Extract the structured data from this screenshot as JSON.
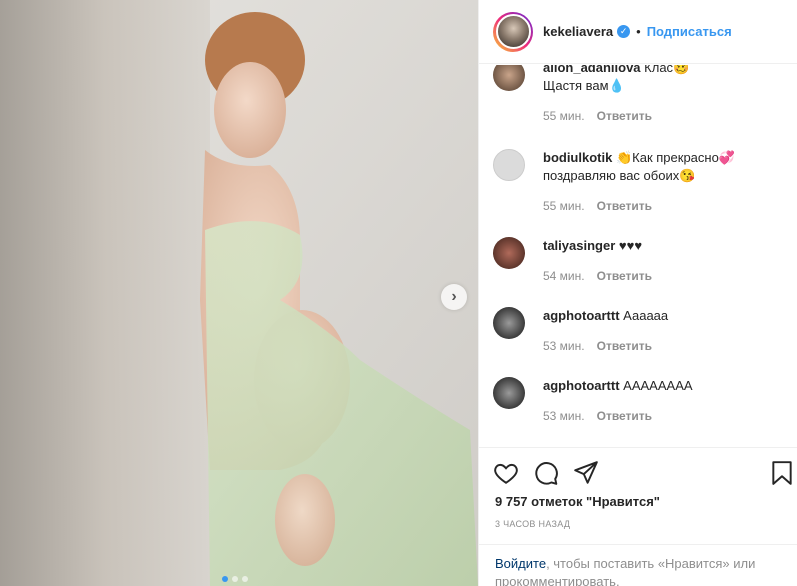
{
  "header": {
    "username": "kekeliavera",
    "separator": "•",
    "follow_label": "Подписаться"
  },
  "comments": [
    {
      "user": "alion_adanilova",
      "text": "Клас🥴",
      "text2": "Щастя вам💧",
      "time": "55 мин.",
      "reply": "Ответить"
    },
    {
      "user": "bodiulkotik",
      "text": "👏Как прекрасно💞",
      "text2": "поздравляю вас обоих😘",
      "time": "55 мин.",
      "reply": "Ответить"
    },
    {
      "user": "taliyasinger",
      "text": "♥♥♥",
      "time": "54 мин.",
      "reply": "Ответить"
    },
    {
      "user": "agphotoarttt",
      "text": "Аааааа",
      "time": "53 мин.",
      "reply": "Ответить"
    },
    {
      "user": "agphotoarttt",
      "text": "АААААААА",
      "time": "53 мин.",
      "reply": "Ответить"
    }
  ],
  "actions": {
    "icons": [
      "heart-icon",
      "comment-icon",
      "share-icon",
      "bookmark-icon"
    ],
    "likes": "9 757 отметок \"Нравится\"",
    "time": "3 ЧАСОВ НАЗАД"
  },
  "login": {
    "link": "Войдите",
    "text": ", чтобы поставить «Нравится» или прокомментировать."
  },
  "carousel": {
    "slides": 3,
    "active": 0
  },
  "colors": {
    "accent": "#3897f0",
    "text": "#262626",
    "muted": "#8e8e8e"
  }
}
